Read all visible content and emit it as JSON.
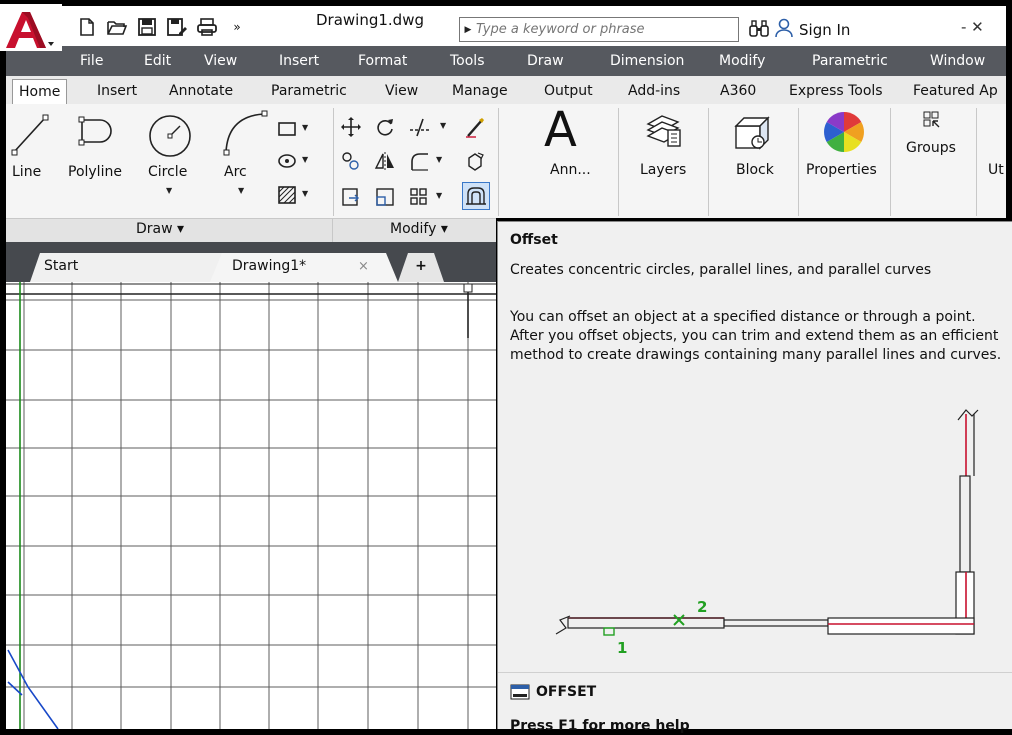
{
  "app": {
    "logo_icon": "autocad-a-logo",
    "quick_access": [
      "new-icon",
      "open-icon",
      "save-icon",
      "save-as-icon",
      "plot-icon",
      "more-icon"
    ],
    "more_glyph": "»",
    "document_title": "Drawing1.dwg",
    "search_placeholder": "Type a keyword or phrase",
    "sign_in": "Sign In",
    "extra_glyph": "- ✕"
  },
  "menu": [
    "File",
    "Edit",
    "View",
    "Insert",
    "Format",
    "Tools",
    "Draw",
    "Dimension",
    "Modify",
    "Parametric",
    "Window"
  ],
  "ribbon_tabs": [
    "Home",
    "Insert",
    "Annotate",
    "Parametric",
    "View",
    "Manage",
    "Output",
    "Add-ins",
    "A360",
    "Express Tools",
    "Featured Ap"
  ],
  "ribbon": {
    "draw_tools": [
      "Line",
      "Polyline",
      "Circle",
      "Arc"
    ],
    "panels": {
      "annotation": "Ann...",
      "layers": "Layers",
      "block": "Block",
      "properties": "Properties",
      "groups": "Groups",
      "utilities": "Ut"
    },
    "panel_titles": {
      "draw": "Draw ▾",
      "modify": "Modify ▾"
    }
  },
  "doc_tabs": {
    "start": "Start",
    "drawing": "Drawing1*",
    "close": "×",
    "new": "+"
  },
  "tooltip": {
    "title": "Offset",
    "summary": "Creates concentric circles, parallel lines, and parallel curves",
    "description": "You can offset an object at a specified distance or through a point. After you offset objects, you can trim and extend them as an efficient method to create drawings containing many parallel lines and curves.",
    "illustration_labels": [
      "1",
      "2"
    ],
    "command": "OFFSET",
    "help": "Press F1 for more help"
  },
  "colors": {
    "menubar": "#56595f",
    "doc_tabs_bg": "#46494e",
    "grid": "#5c5c5c",
    "accent_red": "#c8102e",
    "ucs_green": "#1a8a1a",
    "ucs_blue": "#1848c8",
    "pick_green": "#22a022"
  }
}
